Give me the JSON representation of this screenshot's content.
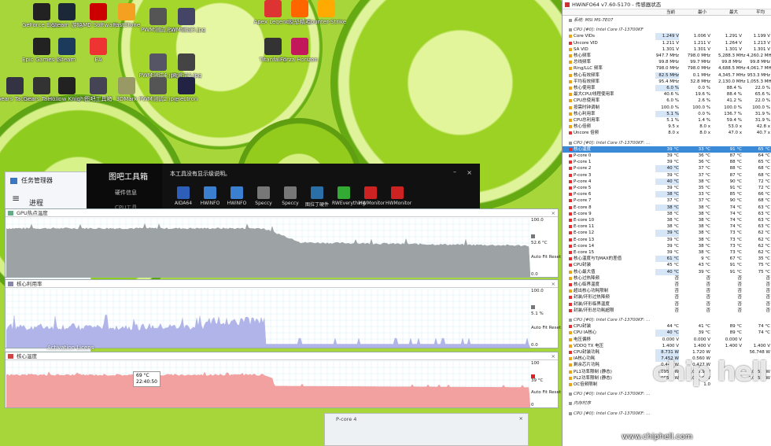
{
  "desktop": {
    "icons": [
      {
        "label": "GeForce Experience",
        "color": "#222"
      },
      {
        "label": "Steam 游戏",
        "color": "#1b2838"
      },
      {
        "label": "AMD Software",
        "color": "#c00"
      },
      {
        "label": "FastStone",
        "color": "#f4a020"
      },
      {
        "label": "PWM测试.jpg",
        "color": "#555"
      },
      {
        "label": "PWM测试3.jpg",
        "color": "#446"
      },
      {
        "label": "Apex Legends",
        "color": "#d33"
      },
      {
        "label": "反恐精英",
        "color": "#f60"
      },
      {
        "label": "Counter-Strike 2",
        "color": "#fa0"
      },
      {
        "label": "Epic Games Launcher",
        "color": "#222"
      },
      {
        "label": "Steam",
        "color": "#1b3a5c"
      },
      {
        "label": "EA",
        "color": "#e33"
      },
      {
        "label": "PWM测试4.jpg",
        "color": "#556"
      },
      {
        "label": "JR测试4.jpg",
        "color": "#444"
      },
      {
        "label": "Titanfall 2",
        "color": "#333"
      },
      {
        "label": "Forza Horizon 5",
        "color": "#c2185b"
      },
      {
        "label": "Gears Tactics",
        "color": "#334"
      },
      {
        "label": "Gears Tactics",
        "color": "#333"
      },
      {
        "label": "Hollow Knight",
        "color": "#222"
      },
      {
        "label": "图吧工具箱",
        "color": "#445"
      },
      {
        "label": "3DMark",
        "color": "#996"
      },
      {
        "label": "PWM测试2.jpg",
        "color": "#555"
      },
      {
        "label": "electron",
        "color": "#224"
      },
      {
        "label": "win10",
        "color": "#358"
      }
    ]
  },
  "taskmanager": {
    "title": "任务管理器",
    "tab": "进程"
  },
  "toolbox": {
    "title": "图吧工具箱",
    "side1": "硬件信息",
    "side2": "CPU工具",
    "message": "本工具没有显示级说明。",
    "tools": [
      "AIDA64",
      "HWiNFO",
      "HWiNFO",
      "Speccy",
      "Speccy",
      "图拉丁硬件",
      "RWEverything",
      "HWMonitor",
      "HWMonitor"
    ]
  },
  "graphs": [
    {
      "title": "GPU热点温度",
      "max": "100.0",
      "cur": "52.6 °C",
      "min": "0.0",
      "buttons": "Auto Fit  Reset",
      "color": "#9da3a5"
    },
    {
      "title": "核心利用率",
      "max": "100.0",
      "cur": "5.1 %",
      "min": "0.0",
      "buttons": "Auto Fit  Reset",
      "color": "#b0b4e8"
    },
    {
      "title": "核心温度",
      "max": "100",
      "cur": "39 °C",
      "min": "0",
      "buttons": "Auto Fit  Reset",
      "color": "#f2a0a0",
      "tooltip_value": "69 °C",
      "tooltip_time": "22:40:50"
    }
  ],
  "overlay_text": "Activation Licens",
  "pcore_window": {
    "title": "P-core 4"
  },
  "hwinfo": {
    "title": "HWiNFO64 v7.60-5170 - 传感器状态",
    "columns": [
      "当前",
      "最小",
      "最大",
      "平均"
    ],
    "rows": [
      {
        "t": "sec",
        "n": "系统: MSI MS-7E07"
      },
      {
        "t": "gap"
      },
      {
        "t": "sec",
        "n": "CPU [#0]: Intel Core i7-13700KF"
      },
      {
        "n": "Core VIDs",
        "c": "1.249 V",
        "mi": "1.006 V",
        "ma": "1.291 V",
        "av": "1.199 V",
        "hc": true
      },
      {
        "n": "Uncore VID",
        "c": "1.211 V",
        "mi": "1.211 V",
        "ma": "1.264 V",
        "av": "1.213 V"
      },
      {
        "n": "SA VID",
        "c": "1.301 V",
        "mi": "1.301 V",
        "ma": "1.301 V",
        "av": "1.301 V"
      },
      {
        "n": "核心频率",
        "c": "947.7 MHz",
        "mi": "798.0 MHz",
        "ma": "5,288.3 MHz",
        "av": "4,260.2 MHz"
      },
      {
        "n": "总线频率",
        "c": "99.8 MHz",
        "mi": "99.7 MHz",
        "ma": "99.8 MHz",
        "av": "99.8 MHz"
      },
      {
        "n": "Ring/LLC 频率",
        "c": "798.0 MHz",
        "mi": "798.0 MHz",
        "ma": "4,688.5 MHz",
        "av": "4,061.7 MHz"
      },
      {
        "n": "核心有效频率",
        "c": "82.5 MHz",
        "mi": "0.1 MHz",
        "ma": "4,345.7 MHz",
        "av": "953.3 MHz",
        "hc": true
      },
      {
        "n": "平均有效频率",
        "c": "95.4 MHz",
        "mi": "32.8 MHz",
        "ma": "2,130.0 MHz",
        "av": "1,055.3 MHz"
      },
      {
        "n": "核心使用率",
        "c": "6.0 %",
        "mi": "0.0 %",
        "ma": "88.4 %",
        "av": "22.0 %",
        "hc": true
      },
      {
        "n": "最大CPU/线程使用率",
        "c": "40.6 %",
        "mi": "19.6 %",
        "ma": "88.4 %",
        "av": "65.6 %"
      },
      {
        "n": "CPU总使用率",
        "c": "6.0 %",
        "mi": "2.6 %",
        "ma": "41.2 %",
        "av": "22.0 %"
      },
      {
        "n": "按需时钟调制",
        "c": "100.0 %",
        "mi": "100.0 %",
        "ma": "100.0 %",
        "av": "100.0 %"
      },
      {
        "n": "核心利用率",
        "c": "5.1 %",
        "mi": "0.0 %",
        "ma": "136.7 %",
        "av": "31.9 %",
        "hc": true
      },
      {
        "n": "CPU总利用率",
        "c": "5.1 %",
        "mi": "1.4 %",
        "ma": "59.4 %",
        "av": "31.9 %"
      },
      {
        "n": "核心倍频",
        "c": "9.5 x",
        "mi": "8.0 x",
        "ma": "53.0 x",
        "av": "42.8 x"
      },
      {
        "n": "Uncore 倍频",
        "c": "8.0 x",
        "mi": "8.0 x",
        "ma": "47.0 x",
        "av": "40.7 x"
      },
      {
        "t": "gap"
      },
      {
        "t": "sec",
        "n": "CPU [#0]: Intel Core i7-13700KF: ..."
      },
      {
        "n": "核心温度",
        "c": "39 °C",
        "mi": "33 °C",
        "ma": "91 °C",
        "av": "65 °C",
        "sel": true
      },
      {
        "n": "P-core 0",
        "c": "39 °C",
        "mi": "36 °C",
        "ma": "87 °C",
        "av": "64 °C"
      },
      {
        "n": "P-core 1",
        "c": "39 °C",
        "mi": "36 °C",
        "ma": "88 °C",
        "av": "65 °C"
      },
      {
        "n": "P-core 2",
        "c": "40 °C",
        "mi": "37 °C",
        "ma": "88 °C",
        "av": "68 °C",
        "hc": true
      },
      {
        "n": "P-core 3",
        "c": "39 °C",
        "mi": "37 °C",
        "ma": "87 °C",
        "av": "68 °C"
      },
      {
        "n": "P-core 4",
        "c": "40 °C",
        "mi": "38 °C",
        "ma": "90 °C",
        "av": "72 °C",
        "hc": true
      },
      {
        "n": "P-core 5",
        "c": "39 °C",
        "mi": "35 °C",
        "ma": "91 °C",
        "av": "72 °C"
      },
      {
        "n": "P-core 6",
        "c": "38 °C",
        "mi": "33 °C",
        "ma": "85 °C",
        "av": "66 °C",
        "hc": true
      },
      {
        "n": "P-core 7",
        "c": "37 °C",
        "mi": "37 °C",
        "ma": "90 °C",
        "av": "68 °C"
      },
      {
        "n": "E-core 8",
        "c": "38 °C",
        "mi": "38 °C",
        "ma": "74 °C",
        "av": "63 °C",
        "hc": true
      },
      {
        "n": "E-core 9",
        "c": "38 °C",
        "mi": "38 °C",
        "ma": "74 °C",
        "av": "63 °C"
      },
      {
        "n": "E-core 10",
        "c": "38 °C",
        "mi": "38 °C",
        "ma": "74 °C",
        "av": "63 °C"
      },
      {
        "n": "E-core 11",
        "c": "38 °C",
        "mi": "38 °C",
        "ma": "74 °C",
        "av": "63 °C"
      },
      {
        "n": "E-core 12",
        "c": "39 °C",
        "mi": "38 °C",
        "ma": "73 °C",
        "av": "62 °C",
        "hc": true
      },
      {
        "n": "E-core 13",
        "c": "39 °C",
        "mi": "38 °C",
        "ma": "73 °C",
        "av": "62 °C"
      },
      {
        "n": "E-core 14",
        "c": "39 °C",
        "mi": "38 °C",
        "ma": "73 °C",
        "av": "62 °C"
      },
      {
        "n": "E-core 15",
        "c": "39 °C",
        "mi": "38 °C",
        "ma": "73 °C",
        "av": "62 °C"
      },
      {
        "n": "核心温度与TjMAX的差值",
        "c": "61 °C",
        "mi": "9 °C",
        "ma": "67 °C",
        "av": "35 °C",
        "hc": true
      },
      {
        "n": "CPU封装",
        "c": "45 °C",
        "mi": "43 °C",
        "ma": "91 °C",
        "av": "75 °C"
      },
      {
        "n": "核心最大值",
        "c": "40 °C",
        "mi": "39 °C",
        "ma": "91 °C",
        "av": "75 °C",
        "hc": true
      },
      {
        "n": "核心过热降频",
        "c": "否",
        "mi": "否",
        "ma": "否",
        "av": "否"
      },
      {
        "n": "核心临界温度",
        "c": "否",
        "mi": "否",
        "ma": "否",
        "av": "否"
      },
      {
        "n": "超出核心功耗限制",
        "c": "否",
        "mi": "否",
        "ma": "否",
        "av": "否"
      },
      {
        "n": "封装/环形过热降频",
        "c": "否",
        "mi": "否",
        "ma": "否",
        "av": "否"
      },
      {
        "n": "封装/环形临界温度",
        "c": "否",
        "mi": "否",
        "ma": "否",
        "av": "否"
      },
      {
        "n": "封装/环形总功耗超限",
        "c": "否",
        "mi": "否",
        "ma": "否",
        "av": "否"
      },
      {
        "t": "gap"
      },
      {
        "t": "sec",
        "n": "CPU [#0]: Intel Core i7-13700KF: ..."
      },
      {
        "n": "CPU封装",
        "c": "44 °C",
        "mi": "41 °C",
        "ma": "89 °C",
        "av": "74 °C"
      },
      {
        "n": "CPU IA核心",
        "c": "40 °C",
        "mi": "39 °C",
        "ma": "89 °C",
        "av": "74 °C",
        "hc": true
      },
      {
        "n": "电压偏移",
        "c": "0.000 V",
        "mi": "0.000 V",
        "ma": "0.000 V",
        "av": ""
      },
      {
        "n": "VDDQ TX 电压",
        "c": "1.400 V",
        "mi": "1.400 V",
        "ma": "1.400 V",
        "av": "1.400 V"
      },
      {
        "n": "CPU封装功耗",
        "c": "8.731 W",
        "mi": "1.720 W",
        "ma": "",
        "av": "56.748 W",
        "hc": true
      },
      {
        "n": "IA核心功耗",
        "c": "7.452 W",
        "mi": "0.560 W",
        "ma": "",
        "av": "",
        "hc": true
      },
      {
        "n": "剩余芯片功耗",
        "c": "0.448 W",
        "mi": "0.427 W",
        "ma": "",
        "av": ""
      },
      {
        "n": "PL1功率限制 (静态)",
        "c": "4,095.9 W",
        "mi": "4,095.9 W",
        "ma": "",
        "av": "4,095.9 W"
      },
      {
        "n": "PL2功率限制 (静态)",
        "c": "4,095.9 W",
        "mi": "4,095.9 W",
        "ma": "",
        "av": "4,095.9 W"
      },
      {
        "n": "OC倍频限制",
        "c": "",
        "mi": "1.0",
        "ma": "",
        "av": ""
      },
      {
        "t": "gap"
      },
      {
        "t": "sec",
        "n": "CPU [#0]: Intel Core i7-13700KF: ..."
      },
      {
        "t": "gap"
      },
      {
        "t": "sec",
        "n": "内存时序"
      },
      {
        "t": "gap"
      },
      {
        "t": "sec",
        "n": "CPU [#0]: Intel Core i7-13700KF: ..."
      }
    ]
  },
  "watermark": {
    "logo": "chip hell",
    "url": "www.chiphell.com"
  }
}
